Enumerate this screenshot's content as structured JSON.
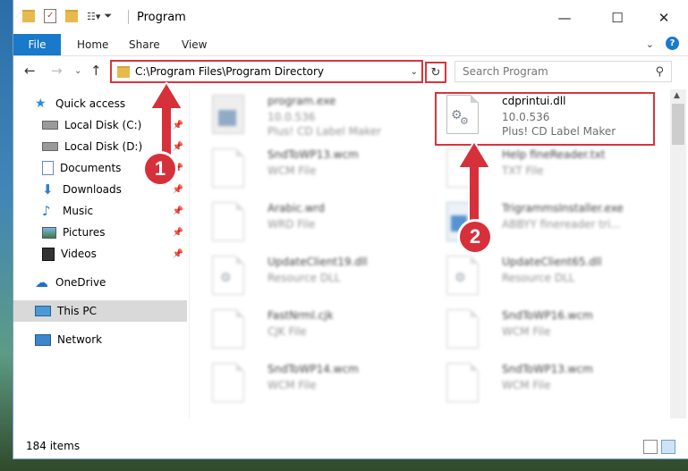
{
  "window": {
    "title": "Program"
  },
  "ribbon": {
    "tabs": [
      "File",
      "Home",
      "Share",
      "View"
    ]
  },
  "address": {
    "path": "C:\\Program Files\\Program Directory"
  },
  "search": {
    "placeholder": "Search Program"
  },
  "sidebar": {
    "items": [
      {
        "label": "Quick access",
        "icon": "star-icon",
        "pinned": false
      },
      {
        "label": "Local Disk (C:)",
        "icon": "drive-icon",
        "pinned": true
      },
      {
        "label": "Local Disk (D:)",
        "icon": "drive-icon",
        "pinned": true
      },
      {
        "label": "Documents",
        "icon": "documents-icon",
        "pinned": true
      },
      {
        "label": "Downloads",
        "icon": "downloads-icon",
        "pinned": true
      },
      {
        "label": "Music",
        "icon": "music-icon",
        "pinned": true
      },
      {
        "label": "Pictures",
        "icon": "pictures-icon",
        "pinned": true
      },
      {
        "label": "Videos",
        "icon": "videos-icon",
        "pinned": true
      },
      {
        "label": "OneDrive",
        "icon": "cloud-icon",
        "pinned": false
      },
      {
        "label": "This PC",
        "icon": "computer-icon",
        "pinned": false
      },
      {
        "label": "Network",
        "icon": "network-icon",
        "pinned": false
      }
    ]
  },
  "files": [
    {
      "name": "program.exe",
      "line1": "10.0.536",
      "line2": "Plus! CD Label Maker",
      "icon": "program-exe-icon"
    },
    {
      "name": "cdprintui.dll",
      "line1": "10.0.536",
      "line2": "Plus! CD Label Maker",
      "icon": "dll-file-icon"
    },
    {
      "name": "SndToWP13.wcm",
      "line1": "WCM File",
      "line2": "",
      "icon": "document-icon"
    },
    {
      "name": "Help fineReader.txt",
      "line1": "TXT File",
      "line2": "",
      "icon": "document-icon"
    },
    {
      "name": "Arabic.wrd",
      "line1": "WRD File",
      "line2": "",
      "icon": "document-icon"
    },
    {
      "name": "TrigrammsInstaller.exe",
      "line1": "ABBYY finereader tri...",
      "line2": "",
      "icon": "installer-icon"
    },
    {
      "name": "UpdateClient19.dll",
      "line1": "Resource DLL",
      "line2": "",
      "icon": "dll-file-icon"
    },
    {
      "name": "UpdateClient65.dll",
      "line1": "Resource DLL",
      "line2": "",
      "icon": "dll-file-icon"
    },
    {
      "name": "FastNrml.cjk",
      "line1": "CJK File",
      "line2": "",
      "icon": "document-icon"
    },
    {
      "name": "SndToWP16.wcm",
      "line1": "WCM File",
      "line2": "",
      "icon": "document-icon"
    },
    {
      "name": "SndToWP14.wcm",
      "line1": "WCM File",
      "line2": "",
      "icon": "document-icon"
    },
    {
      "name": "SndToWP13.wcm",
      "line1": "WCM File",
      "line2": "",
      "icon": "document-icon"
    }
  ],
  "status": {
    "item_count": "184 items"
  },
  "annotations": {
    "step1": "1",
    "step2": "2"
  },
  "colors": {
    "accent": "#1979ca",
    "highlight": "#d9343d"
  }
}
